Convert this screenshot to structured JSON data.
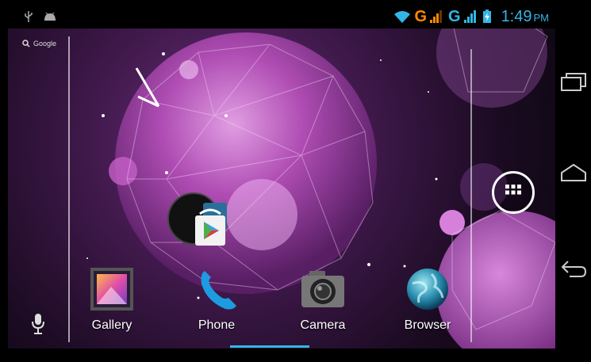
{
  "status_bar": {
    "network_1": "G",
    "network_2": "G",
    "time": "1:49",
    "ampm": "PM"
  },
  "search": {
    "label": "Google"
  },
  "dock": [
    {
      "id": "gallery",
      "label": "Gallery"
    },
    {
      "id": "phone",
      "label": "Phone"
    },
    {
      "id": "camera",
      "label": "Camera"
    },
    {
      "id": "browser",
      "label": "Browser"
    }
  ],
  "colors": {
    "accent": "#33b5e5",
    "network_orange": "#ff8800",
    "network_blue": "#33b5e5"
  }
}
